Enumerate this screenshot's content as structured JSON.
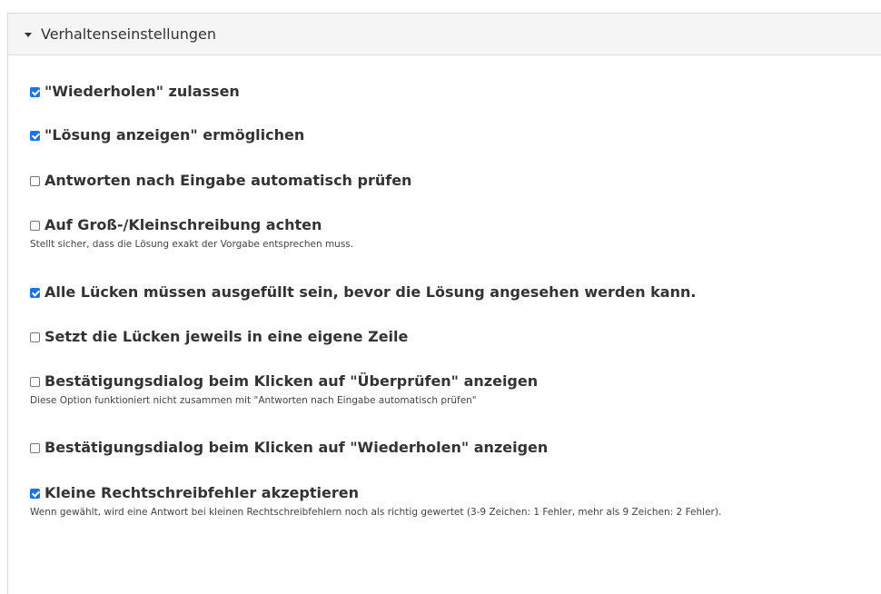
{
  "section": {
    "title": "Verhaltenseinstellungen"
  },
  "options": [
    {
      "label": "\"Wiederholen\" zulassen",
      "checked": true,
      "description": ""
    },
    {
      "label": "\"Lösung anzeigen\" ermöglichen",
      "checked": true,
      "description": ""
    },
    {
      "label": "Antworten nach Eingabe automatisch prüfen",
      "checked": false,
      "description": ""
    },
    {
      "label": "Auf Groß-/Kleinschreibung achten",
      "checked": false,
      "description": "Stellt sicher, dass die Lösung exakt der Vorgabe entsprechen muss."
    },
    {
      "label": "Alle Lücken müssen ausgefüllt sein, bevor die Lösung angesehen werden kann.",
      "checked": true,
      "description": ""
    },
    {
      "label": "Setzt die Lücken jeweils in eine eigene Zeile",
      "checked": false,
      "description": ""
    },
    {
      "label": "Bestätigungsdialog beim Klicken auf \"Überprüfen\" anzeigen",
      "checked": false,
      "description": "Diese Option funktioniert nicht zusammen mit \"Antworten nach Eingabe automatisch prüfen\""
    },
    {
      "label": "Bestätigungsdialog beim Klicken auf \"Wiederholen\" anzeigen",
      "checked": false,
      "description": ""
    },
    {
      "label": "Kleine Rechtschreibfehler akzeptieren",
      "checked": true,
      "description": "Wenn gewählt, wird eine Antwort bei kleinen Rechtschreibfehlern noch als richtig gewertet (3-9 Zeichen: 1 Fehler, mehr als 9 Zeichen: 2 Fehler)."
    }
  ],
  "colors": {
    "checkbox_checked": "#1a73e8",
    "header_background": "#f5f5f5"
  }
}
